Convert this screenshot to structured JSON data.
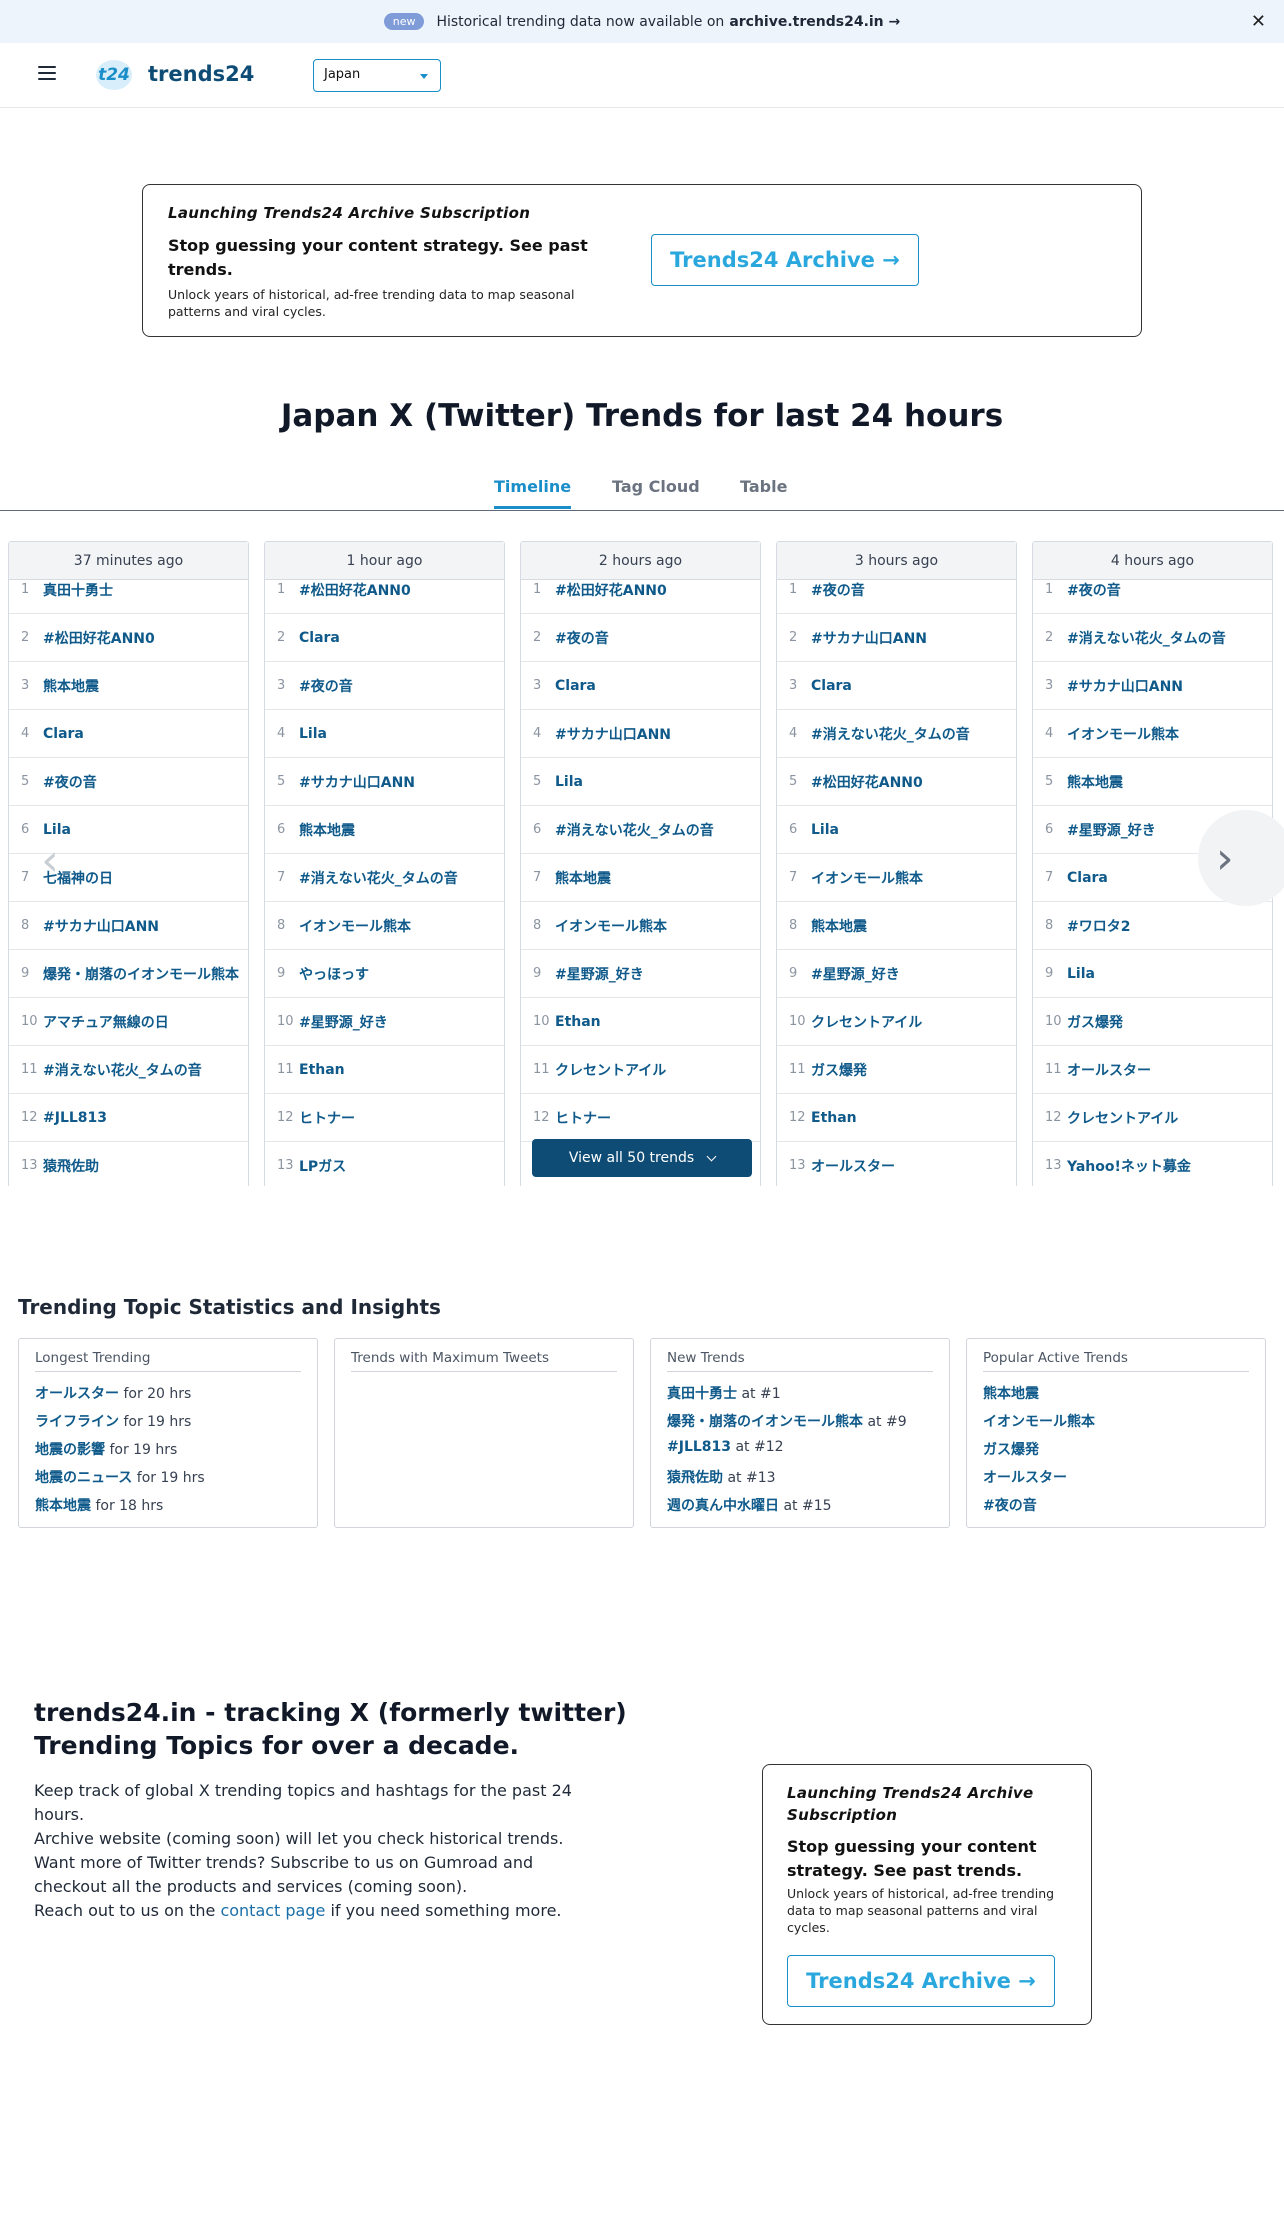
{
  "announcement": {
    "badge": "new",
    "text": "Historical trending data now available on",
    "link": "archive.trends24.in →",
    "close": "✕"
  },
  "header": {
    "logo_mark": "t24",
    "logo_text": "trends24",
    "country": "Japan"
  },
  "promo": {
    "kicker": "Launching Trends24 Archive Subscription",
    "headline": "Stop guessing your content strategy. See past trends.",
    "sub": "Unlock years of historical, ad-free trending data to map seasonal patterns and viral cycles.",
    "cta": "Trends24 Archive →"
  },
  "page_title": "Japan X (Twitter) Trends for last 24 hours",
  "tabs": [
    {
      "label": "Timeline",
      "active": true
    },
    {
      "label": "Tag Cloud",
      "active": false
    },
    {
      "label": "Table",
      "active": false
    }
  ],
  "timeline": [
    {
      "time": "37 minutes ago",
      "trends": [
        "真田十勇士",
        "#松田好花ANN0",
        "熊本地震",
        "Clara",
        "#夜の音",
        "Lila",
        "七福神の日",
        "#サカナ山口ANN",
        "爆発・崩落のイオンモール熊本",
        "アマチュア無線の日",
        "#消えない花火_タムの音",
        "#JLL813",
        "猿飛佐助"
      ]
    },
    {
      "time": "1 hour ago",
      "trends": [
        "#松田好花ANN0",
        "Clara",
        "#夜の音",
        "Lila",
        "#サカナ山口ANN",
        "熊本地震",
        "#消えない花火_タムの音",
        "イオンモール熊本",
        "やっほっす",
        "#星野源_好き",
        "Ethan",
        "ヒトナー",
        "LPガス"
      ]
    },
    {
      "time": "2 hours ago",
      "trends": [
        "#松田好花ANN0",
        "#夜の音",
        "Clara",
        "#サカナ山口ANN",
        "Lila",
        "#消えない花火_タムの音",
        "熊本地震",
        "イオンモール熊本",
        "#星野源_好き",
        "Ethan",
        "クレセントアイル",
        "ヒトナー"
      ]
    },
    {
      "time": "3 hours ago",
      "trends": [
        "#夜の音",
        "#サカナ山口ANN",
        "Clara",
        "#消えない花火_タムの音",
        "#松田好花ANN0",
        "Lila",
        "イオンモール熊本",
        "熊本地震",
        "#星野源_好き",
        "クレセントアイル",
        "ガス爆発",
        "Ethan",
        "オールスター"
      ]
    },
    {
      "time": "4 hours ago",
      "trends": [
        "#夜の音",
        "#消えない花火_タムの音",
        "#サカナ山口ANN",
        "イオンモール熊本",
        "熊本地震",
        "#星野源_好き",
        "Clara",
        "#ワロタ2",
        "Lila",
        "ガス爆発",
        "オールスター",
        "クレセントアイル",
        "Yahoo!ネット募金"
      ]
    }
  ],
  "view_all": "View all 50 trends",
  "stats": {
    "title": "Trending Topic Statistics and Insights",
    "cards": [
      {
        "title": "Longest Trending",
        "items": [
          {
            "name": "オールスター",
            "suffix": " for 20 hrs"
          },
          {
            "name": "ライフライン",
            "suffix": " for 19 hrs"
          },
          {
            "name": "地震の影響",
            "suffix": " for 19 hrs"
          },
          {
            "name": "地震のニュース",
            "suffix": " for 19 hrs"
          },
          {
            "name": "熊本地震",
            "suffix": " for 18 hrs"
          }
        ]
      },
      {
        "title": "Trends with Maximum Tweets",
        "items": []
      },
      {
        "title": "New Trends",
        "items": [
          {
            "name": "真田十勇士",
            "suffix": " at #1"
          },
          {
            "name": "爆発・崩落のイオンモール熊本",
            "suffix": " at #9"
          },
          {
            "name": "#JLL813",
            "suffix": " at #12"
          },
          {
            "name": "猿飛佐助",
            "suffix": " at #13"
          },
          {
            "name": "週の真ん中水曜日",
            "suffix": " at #15"
          }
        ]
      },
      {
        "title": "Popular Active Trends",
        "items": [
          {
            "name": "熊本地震",
            "suffix": ""
          },
          {
            "name": "イオンモール熊本",
            "suffix": ""
          },
          {
            "name": "ガス爆発",
            "suffix": ""
          },
          {
            "name": "オールスター",
            "suffix": ""
          },
          {
            "name": "#夜の音",
            "suffix": ""
          }
        ]
      }
    ]
  },
  "about": {
    "title": "trends24.in - tracking X (formerly twitter) Trending Topics for over a decade.",
    "line1": "Keep track of global X trending topics and hashtags for the past 24 hours.",
    "line2": "Archive website (coming soon) will let you check historical trends.",
    "line3": "Want more of Twitter trends? Subscribe to us on Gumroad and checkout all the products and services (coming soon).",
    "line4_pre": "Reach out to us on the ",
    "line4_link": "contact page",
    "line4_post": " if you need something more."
  },
  "promo2": {
    "kicker": "Launching Trends24 Archive Subscription",
    "headline": "Stop guessing your content strategy. See past trends.",
    "sub": "Unlock years of historical, ad-free trending data to map seasonal patterns and viral cycles.",
    "cta": "Trends24 Archive →"
  },
  "icons": {
    "prev": "‹",
    "next": "›"
  }
}
